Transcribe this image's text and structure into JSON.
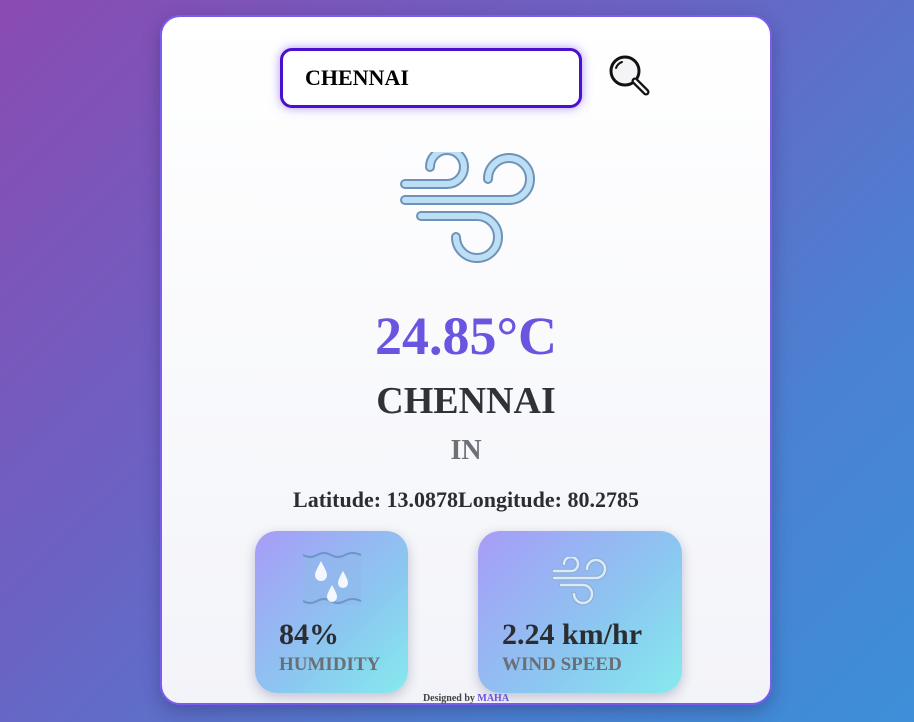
{
  "search": {
    "value": "CHENNAI"
  },
  "weather": {
    "icon": "wind-icon",
    "temperature": "24.85°C",
    "city": "CHENNAI",
    "country": "IN",
    "latitude_text": "Latitude: 13.0878",
    "longitude_text": "Longitude: 80.2785"
  },
  "stats": {
    "humidity": {
      "icon": "humidity-icon",
      "value": "84%",
      "label": "HUMIDITY"
    },
    "wind": {
      "icon": "wind-icon",
      "value": "2.24 km/hr",
      "label": "WIND SPEED"
    }
  },
  "footer": {
    "prefix": "Designed by",
    "author": "MAHA"
  },
  "colors": {
    "accent": "#6a55e0",
    "input_border": "#4b0fcf",
    "card_border": "#7b5cf0"
  }
}
